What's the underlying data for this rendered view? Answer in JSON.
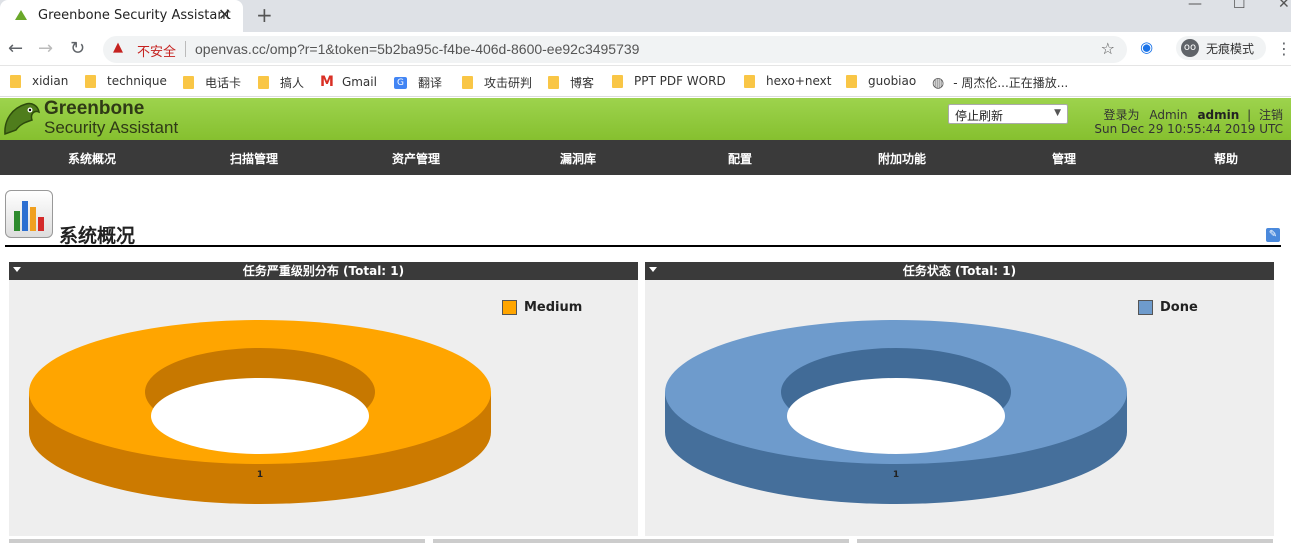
{
  "browser": {
    "tab_title": "Greenbone Security Assistant",
    "close_glyph": "✕",
    "newtab_glyph": "+",
    "security_label": "不安全",
    "url": "openvas.cc/omp?r=1&token=5b2ba95c-f4be-406d-8600-ee92c3495739",
    "incognito_label": "无痕模式",
    "bookmarks": [
      {
        "label": "xidian",
        "icon": "folder-icon"
      },
      {
        "label": "technique",
        "icon": "folder-icon"
      },
      {
        "label": "电话卡",
        "icon": "folder-icon"
      },
      {
        "label": "搞人",
        "icon": "folder-icon"
      },
      {
        "label": "Gmail",
        "icon": "gmail-icon"
      },
      {
        "label": "翻译",
        "icon": "translate-icon"
      },
      {
        "label": "攻击研判",
        "icon": "folder-icon"
      },
      {
        "label": "博客",
        "icon": "folder-icon"
      },
      {
        "label": "PPT PDF WORD",
        "icon": "folder-icon"
      },
      {
        "label": "hexo+next",
        "icon": "folder-icon"
      },
      {
        "label": "guobiao",
        "icon": "folder-icon"
      },
      {
        "label": "- 周杰伦...正在播放...",
        "icon": "globe-icon"
      }
    ]
  },
  "gsa": {
    "logo_line1": "Greenbone",
    "logo_line2": "Security Assistant",
    "refresh_select": "停止刷新",
    "login_prefix": "登录为",
    "role": "Admin",
    "username": "admin",
    "logout": "注销",
    "datetime": "Sun Dec 29 10:55:44 2019 UTC",
    "menu": [
      "系统概况",
      "扫描管理",
      "资产管理",
      "漏洞库",
      "配置",
      "附加功能",
      "管理",
      "帮助"
    ],
    "page_title": "系统概况"
  },
  "panels": [
    {
      "title": "任务严重级别分布 (Total: 1)",
      "legend": "Medium",
      "color": "#ffa500",
      "side_color": "#cc7a00",
      "inner_color": "#c77800",
      "value_label": "1"
    },
    {
      "title": "任务状态 (Total: 1)",
      "legend": "Done",
      "color": "#6e9bcc",
      "side_color": "#456f9b",
      "inner_color": "#416b97",
      "value_label": "1"
    }
  ],
  "chart_data": [
    {
      "type": "pie",
      "title": "任务严重级别分布 (Total: 1)",
      "categories": [
        "Medium"
      ],
      "values": [
        1
      ],
      "legend_position": "top-right"
    },
    {
      "type": "pie",
      "title": "任务状态 (Total: 1)",
      "categories": [
        "Done"
      ],
      "values": [
        1
      ],
      "legend_position": "top-right"
    }
  ]
}
